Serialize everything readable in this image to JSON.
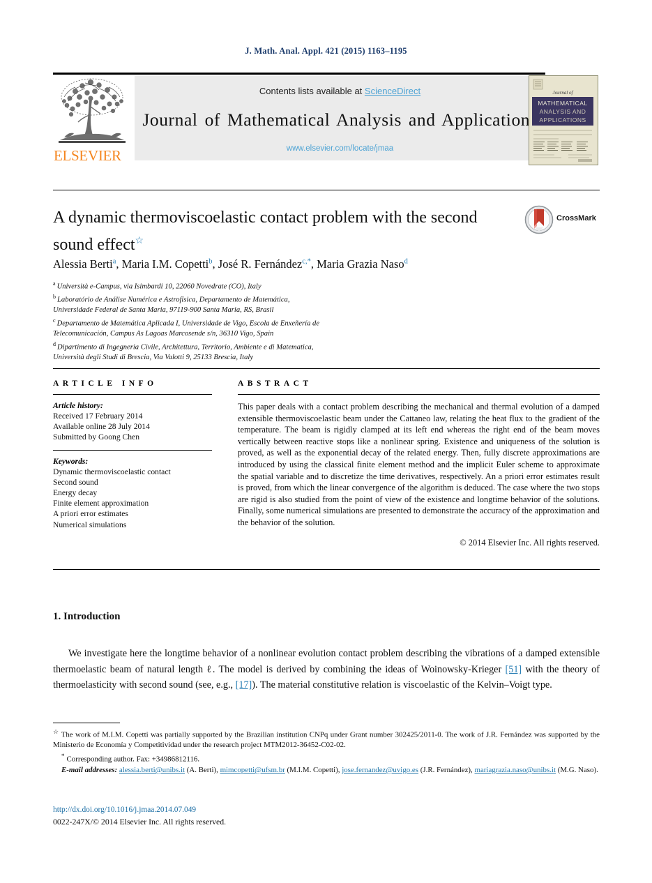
{
  "running_head": "J. Math. Anal. Appl. 421 (2015) 1163–1195",
  "masthead": {
    "contents_text": "Contents lists available at ",
    "sciencedirect": "ScienceDirect",
    "journal_title": "Journal of Mathematical Analysis and Applications",
    "journal_url": "www.elsevier.com/locate/jmaa",
    "publisher_wordmark": "ELSEVIER",
    "cover_line1": "Journal of",
    "cover_line2": "MATHEMATICAL",
    "cover_line3": "ANALYSIS AND",
    "cover_line4": "APPLICATIONS",
    "colors": {
      "elsevier_orange": "#f5861f",
      "link_blue": "#4da3d4",
      "banner_gray": "#ebebeb",
      "cover_navy": "#3b3560",
      "cover_cream": "#e8e4cf"
    }
  },
  "article": {
    "title": "A dynamic thermoviscoelastic contact problem with the second sound effect",
    "title_footnote_mark": "☆",
    "crossmark_label": "CrossMark",
    "authors": [
      {
        "name": "Alessia Berti",
        "mark": "a"
      },
      {
        "name": "Maria I.M. Copetti",
        "mark": "b"
      },
      {
        "name": "José R. Fernández",
        "mark": "c,*"
      },
      {
        "name": "Maria Grazia Naso",
        "mark": "d"
      }
    ],
    "affiliations": [
      {
        "mark": "a",
        "lines": [
          "Università e-Campus, via Isimbardi 10, 22060 Novedrate (CO), Italy"
        ]
      },
      {
        "mark": "b",
        "lines": [
          "Laboratório de Análise Numérica e Astrofísica, Departamento de Matemática,",
          "Universidade Federal de Santa Maria, 97119-900 Santa Maria, RS, Brasil"
        ]
      },
      {
        "mark": "c",
        "lines": [
          "Departamento de Matemática Aplicada I, Universidade de Vigo, Escola de Enxeñería de",
          "Telecomunicación, Campus As Lagoas Marcosende s/n, 36310 Vigo, Spain"
        ]
      },
      {
        "mark": "d",
        "lines": [
          "Dipartimento di Ingegneria Civile, Architettura, Territorio, Ambiente e di Matematica,",
          "Università degli Studi di Brescia, Via Valotti 9, 25133 Brescia, Italy"
        ]
      }
    ]
  },
  "info": {
    "heading": "ARTICLE INFO",
    "history_label": "Article history:",
    "history": [
      "Received 17 February 2014",
      "Available online 28 July 2014",
      "Submitted by Goong Chen"
    ],
    "keywords_label": "Keywords:",
    "keywords": [
      "Dynamic thermoviscoelastic contact",
      "Second sound",
      "Energy decay",
      "Finite element approximation",
      "A priori error estimates",
      "Numerical simulations"
    ]
  },
  "abstract": {
    "heading": "ABSTRACT",
    "text": "This paper deals with a contact problem describing the mechanical and thermal evolution of a damped extensible thermoviscoelastic beam under the Cattaneo law, relating the heat flux to the gradient of the temperature. The beam is rigidly clamped at its left end whereas the right end of the beam moves vertically between reactive stops like a nonlinear spring. Existence and uniqueness of the solution is proved, as well as the exponential decay of the related energy. Then, fully discrete approximations are introduced by using the classical finite element method and the implicit Euler scheme to approximate the spatial variable and to discretize the time derivatives, respectively. An a priori error estimates result is proved, from which the linear convergence of the algorithm is deduced. The case where the two stops are rigid is also studied from the point of view of the existence and longtime behavior of the solutions. Finally, some numerical simulations are presented to demonstrate the accuracy of the approximation and the behavior of the solution.",
    "copyright": "© 2014 Elsevier Inc. All rights reserved."
  },
  "body": {
    "section_number_title": "1. Introduction",
    "paragraph_1": "We investigate here the longtime behavior of a nonlinear evolution contact problem describing the vibrations of a damped extensible thermoelastic beam of natural length ℓ. The model is derived by combining the ideas of Woinowsky-Krieger ",
    "cite_51": "[51]",
    "paragraph_2": " with the theory of thermoelasticity with second sound (see, e.g., ",
    "cite_17": "[17]",
    "paragraph_3": "). The material constitutive relation is viscoelastic of the Kelvin–Voigt type."
  },
  "footnotes": {
    "star_mark": "☆",
    "funding": "The work of M.I.M. Copetti was partially supported by the Brazilian institution CNPq under Grant number 302425/2011-0. The work of J.R. Fernández was supported by the Ministerio de Economía y Competitividad under the research project MTM2012-36452-C02-02.",
    "corresponding_mark": "*",
    "corresponding": "Corresponding author. Fax: +34986812116.",
    "email_label": "E-mail addresses:",
    "emails": [
      {
        "address": "alessia.berti@unibs.it",
        "person": "(A. Berti),"
      },
      {
        "address": "mimcopetti@ufsm.br",
        "person": "(M.I.M. Copetti),"
      },
      {
        "address": "jose.fernandez@uvigo.es",
        "person": "(J.R. Fernández),"
      },
      {
        "address": "mariagrazia.naso@unibs.it",
        "person": "(M.G. Naso)."
      }
    ]
  },
  "footer": {
    "doi": "http://dx.doi.org/10.1016/j.jmaa.2014.07.049",
    "issn_line": "0022-247X/© 2014 Elsevier Inc. All rights reserved."
  }
}
